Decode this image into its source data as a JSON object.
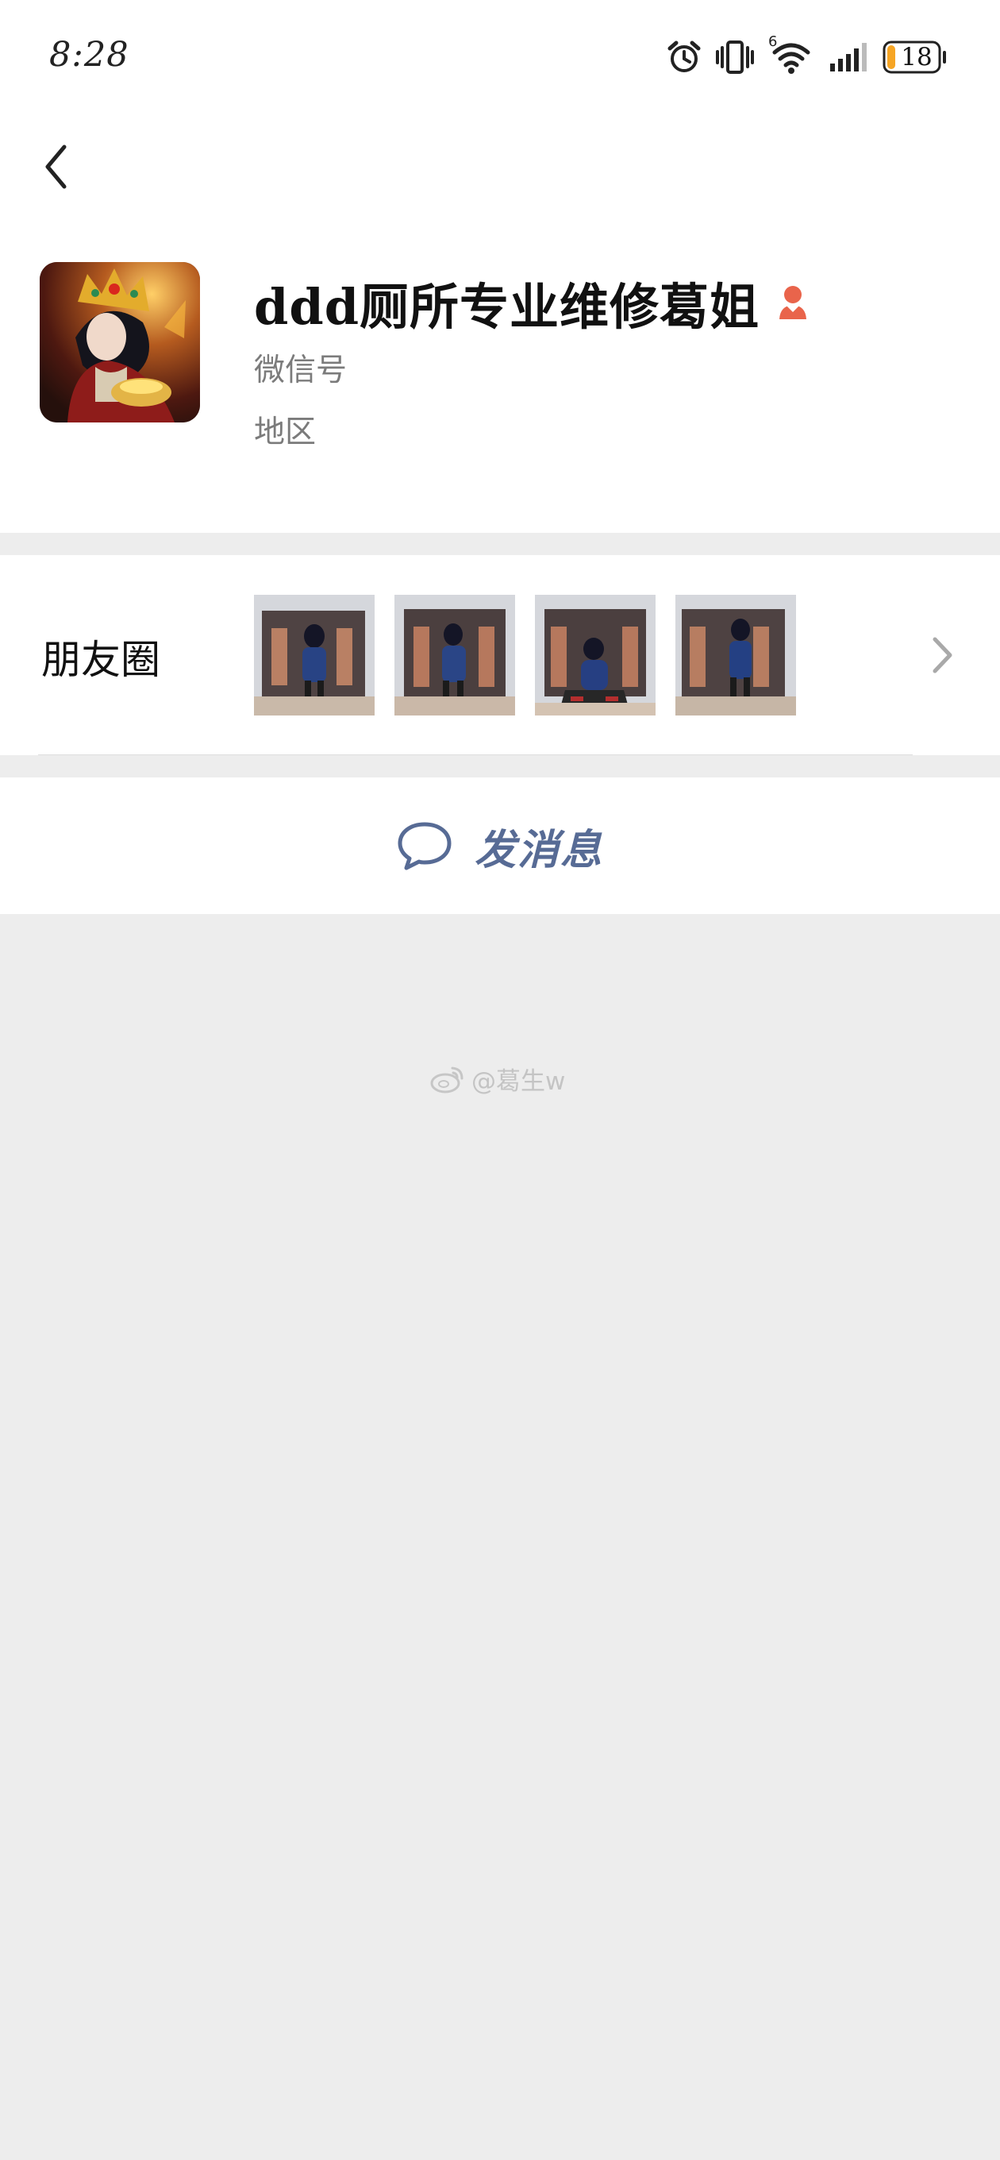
{
  "status_bar": {
    "time": "8:28",
    "network_label": "6",
    "battery_level": "18",
    "icons": [
      "alarm-icon",
      "vibrate-icon",
      "wifi-icon",
      "signal-icon",
      "battery-icon"
    ]
  },
  "header": {
    "back_icon": "chevron-left-icon"
  },
  "profile": {
    "name": "ddd厕所专业维修葛姐",
    "wechat_id_label": "微信号",
    "region_label": "地区",
    "gender_icon": "female-user-icon",
    "gender_color": "#e9644b"
  },
  "moments": {
    "label": "朋友圈",
    "thumbnail_count": 4,
    "chevron_icon": "chevron-right-icon"
  },
  "actions": {
    "send_message_label": "发消息",
    "send_message_icon": "chat-bubble-icon",
    "accent_color": "#576b95"
  },
  "watermark": {
    "text": "@葛生w",
    "icon": "weibo-icon"
  }
}
